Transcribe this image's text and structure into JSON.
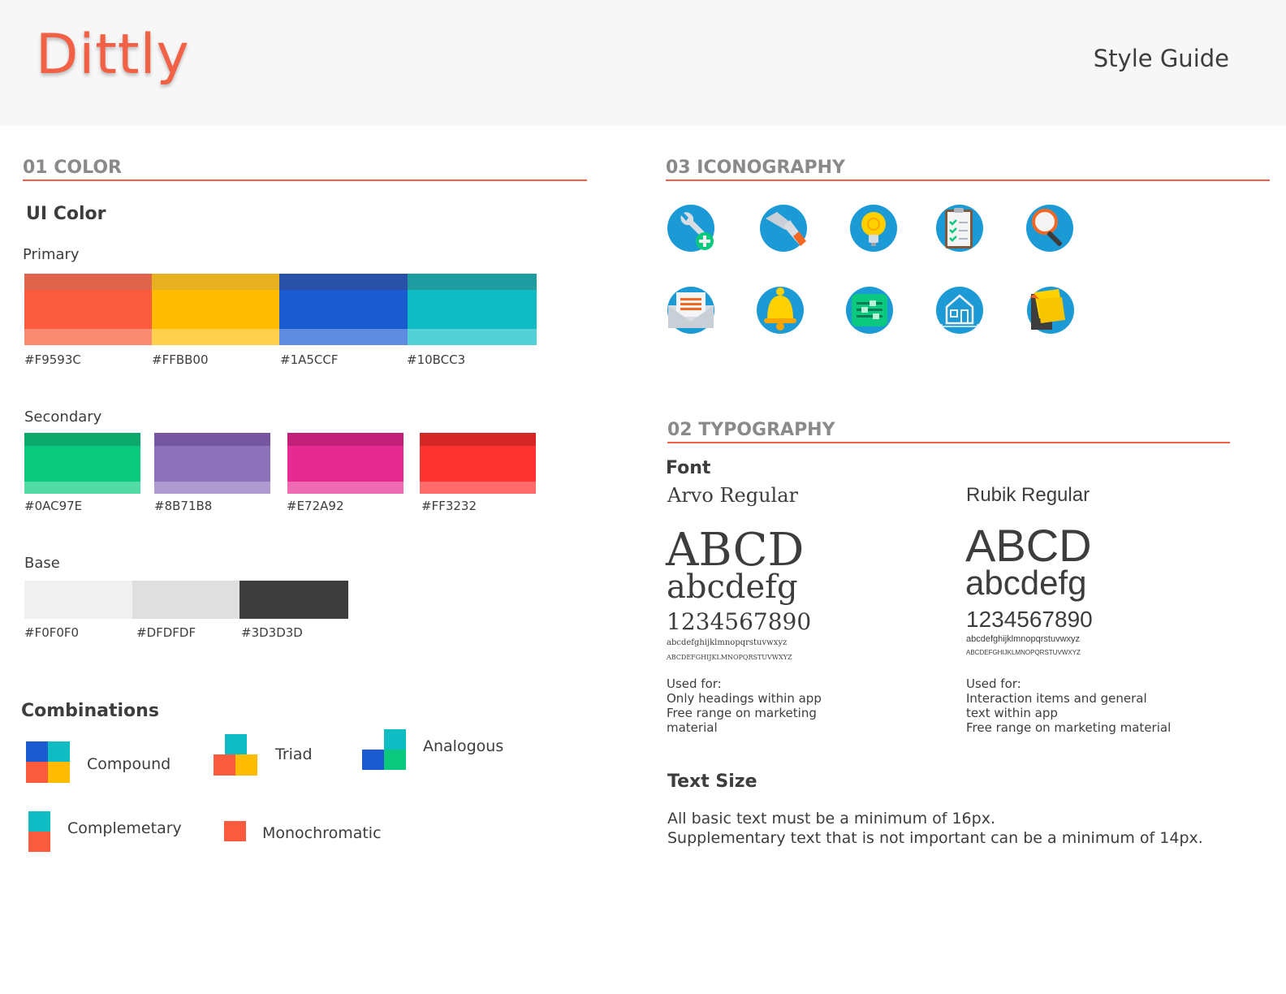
{
  "header": {
    "logo": "Dittly",
    "title": "Style Guide"
  },
  "color_section": {
    "title": "01 COLOR",
    "ui_color": "UI Color",
    "primary_label": "Primary",
    "primary": [
      {
        "hex_label": "#F9593C",
        "dark": "#e0634c",
        "main": "#fa5b3d",
        "light": "#fb8a73"
      },
      {
        "hex_label": "#FFBB00",
        "dark": "#e6b021",
        "main": "#ffbb00",
        "light": "#ffd04d"
      },
      {
        "hex_label": "#1A5CCF",
        "dark": "#2a51a8",
        "main": "#1a5ccf",
        "light": "#5e8be0"
      },
      {
        "hex_label": "#10BCC3",
        "dark": "#1e9ca0",
        "main": "#10bcc3",
        "light": "#54d1d6"
      }
    ],
    "secondary_label": "Secondary",
    "secondary": [
      {
        "hex_label": "#0AC97E",
        "dark": "#0aa86a",
        "main": "#0ac97e",
        "light": "#52dba5"
      },
      {
        "hex_label": "#8B71B8",
        "dark": "#7556a1",
        "main": "#8b71b8",
        "light": "#ae9bd0"
      },
      {
        "hex_label": "#E72A92",
        "dark": "#c21f79",
        "main": "#e72a92",
        "light": "#ef6cb4"
      },
      {
        "hex_label": "#FF3232",
        "dark": "#d62727",
        "main": "#ff3232",
        "light": "#ff6b6b"
      }
    ],
    "base_label": "Base",
    "base": [
      {
        "hex_label": "#F0F0F0",
        "main": "#f0f0f0"
      },
      {
        "hex_label": "#DFDFDF",
        "main": "#dfdfdf"
      },
      {
        "hex_label": "#3D3D3D",
        "main": "#3d3d3d"
      }
    ],
    "combinations_title": "Combinations",
    "combinations": {
      "compound": "Compound",
      "triad": "Triad",
      "analogous": "Analogous",
      "complementary": "Complemetary",
      "monochromatic": "Monochromatic"
    }
  },
  "iconography": {
    "title": "03 ICONOGRAPHY",
    "icons": [
      "wrench-add-icon",
      "hammer-icon",
      "lightbulb-icon",
      "checklist-icon",
      "magnifier-icon",
      "envelope-icon",
      "bell-icon",
      "settings-sliders-icon",
      "house-plan-icon",
      "sticky-notes-icon"
    ]
  },
  "typography": {
    "title": "02 TYPOGRAPHY",
    "font_heading": "Font",
    "arvo": {
      "name": "Arvo Regular",
      "upper": "ABCD",
      "lower": "abcdefg",
      "digits": "1234567890",
      "alpha_lower": "abcdefghijklmnopqrstuvwxyz",
      "alpha_upper": "ABCDEFGHIJKLMNOPQRSTUVWXYZ",
      "used_for": "Used for:",
      "uses": [
        "Only headings within app",
        "Free range on marketing",
        "material"
      ]
    },
    "rubik": {
      "name": "Rubik Regular",
      "upper": "ABCD",
      "lower": "abcdefg",
      "digits": "1234567890",
      "alpha_lower": "abcdefghijklmnopqrstuvwxyz",
      "alpha_upper": "ABCDEFGHIJKLMNOPQRSTUVWXYZ",
      "used_for": "Used for:",
      "uses": [
        "Interaction items and general",
        "text within app",
        "Free range on marketing material"
      ]
    },
    "text_size_heading": "Text Size",
    "text_size_lines": [
      "All basic text must be a minimum of 16px.",
      "Supplementary text that is not important can be a minimum of 14px."
    ]
  }
}
